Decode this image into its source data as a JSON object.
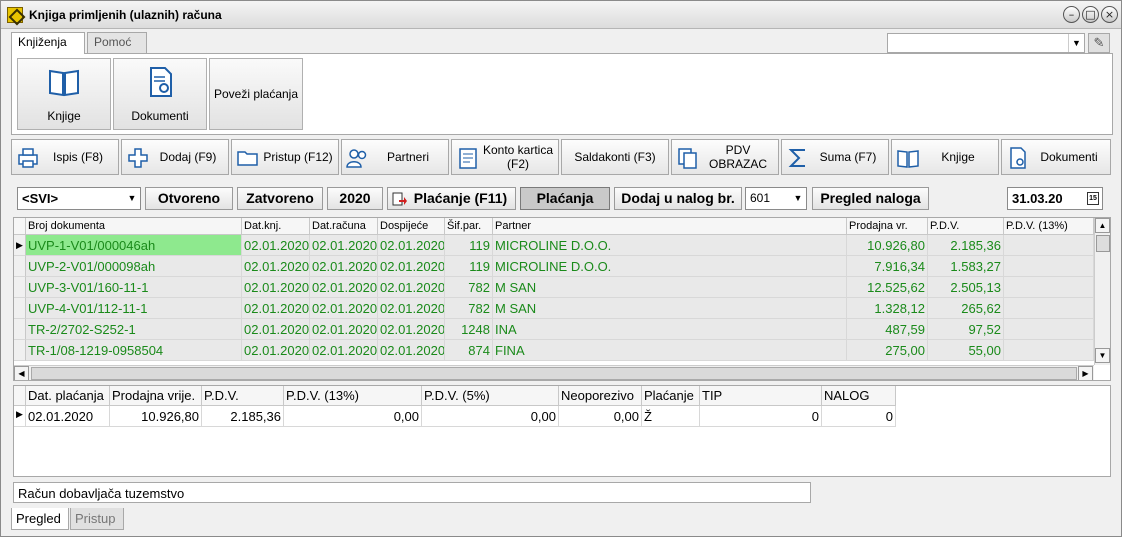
{
  "window": {
    "title": "Knjiga primljenih (ulaznih) računa"
  },
  "menu_tabs": [
    {
      "label": "Knjiženja"
    },
    {
      "label": "Pomoć"
    }
  ],
  "ribbon": {
    "knjige_label": "Knjige",
    "dokumenti_label": "Dokumenti",
    "povezi_label": "Poveži plaćanja"
  },
  "toolbar": [
    {
      "label": "Ispis (F8)",
      "icon": "printer-icon"
    },
    {
      "label": "Dodaj (F9)",
      "icon": "plus-icon"
    },
    {
      "label": "Pristup (F12)",
      "icon": "folder-icon"
    },
    {
      "label": "Partneri",
      "icon": "people-icon"
    },
    {
      "label": "Konto kartica (F2)",
      "icon": "ledger-icon"
    },
    {
      "label": "Saldakonti (F3)",
      "icon": ""
    },
    {
      "label": "PDV OBRAZAC",
      "icon": "documents-icon"
    },
    {
      "label": "Suma (F7)",
      "icon": "sigma-icon"
    },
    {
      "label": "Knjige",
      "icon": "book-icon"
    },
    {
      "label": "Dokumenti",
      "icon": "document-gear-icon"
    }
  ],
  "filters": {
    "selector_value": "<SVI>",
    "otvoreno": "Otvoreno",
    "zatvoreno": "Zatvoreno",
    "year": "2020",
    "placanje_f11": "Plaćanje (F11)",
    "placanja": "Plaćanja",
    "dodaj_nalog": "Dodaj u nalog br.",
    "nalog_value": "601",
    "pregled_naloga": "Pregled naloga",
    "date": "31.03.20",
    "calendar_icon": "calendar-icon"
  },
  "grid1": {
    "headers": [
      "Broj dokumenta",
      "Dat.knj.",
      "Dat.računa",
      "Dospijeće",
      "Šif.par.",
      "Partner",
      "Prodajna vr.",
      "P.D.V.",
      "P.D.V. (13%)"
    ],
    "rows": [
      [
        "UVP-1-V01/000046ah",
        "02.01.2020",
        "02.01.2020",
        "02.01.2020",
        "119",
        "MICROLINE D.O.O.",
        "10.926,80",
        "2.185,36",
        ""
      ],
      [
        "UVP-2-V01/000098ah",
        "02.01.2020",
        "02.01.2020",
        "02.01.2020",
        "119",
        "MICROLINE D.O.O.",
        "7.916,34",
        "1.583,27",
        ""
      ],
      [
        "UVP-3-V01/160-11-1",
        "02.01.2020",
        "02.01.2020",
        "02.01.2020",
        "782",
        "M SAN",
        "12.525,62",
        "2.505,13",
        ""
      ],
      [
        "UVP-4-V01/112-11-1",
        "02.01.2020",
        "02.01.2020",
        "02.01.2020",
        "782",
        "M SAN",
        "1.328,12",
        "265,62",
        ""
      ],
      [
        "TR-2/2702-S252-1",
        "02.01.2020",
        "02.01.2020",
        "02.01.2020",
        "1248",
        "INA",
        "487,59",
        "97,52",
        ""
      ],
      [
        "TR-1/08-1219-0958504",
        "02.01.2020",
        "02.01.2020",
        "02.01.2020",
        "874",
        "FINA",
        "275,00",
        "55,00",
        ""
      ]
    ]
  },
  "grid2": {
    "headers": [
      "Dat. plaćanja",
      "Prodajna vrije.",
      "P.D.V.",
      "P.D.V. (13%)",
      "P.D.V. (5%)",
      "Neoporezivo",
      "Plaćanje",
      "TIP",
      "NALOG"
    ],
    "rows": [
      [
        "02.01.2020",
        "10.926,80",
        "2.185,36",
        "0,00",
        "0,00",
        "0,00",
        "Ž",
        "0",
        "0"
      ]
    ]
  },
  "note": "Račun dobavljača tuzemstvo",
  "bottom_tabs": [
    {
      "label": "Pregled"
    },
    {
      "label": "Pristup"
    }
  ]
}
